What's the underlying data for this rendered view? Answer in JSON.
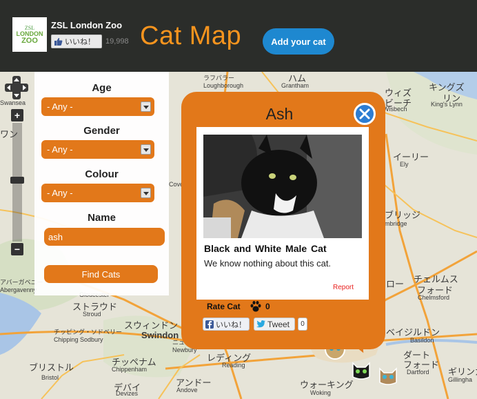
{
  "header": {
    "org_name": "ZSL London Zoo",
    "logo": {
      "line1": "ZSL",
      "line2": "LONDON",
      "line3": "ZOO"
    },
    "like_label": "いいね！",
    "like_count": "19,998",
    "site_title": "Cat Map",
    "add_cat_label": "Add your cat"
  },
  "filters": {
    "age_label": "Age",
    "age_value": "- Any -",
    "gender_label": "Gender",
    "gender_value": "- Any -",
    "colour_label": "Colour",
    "colour_value": "- Any -",
    "name_label": "Name",
    "name_value": "ash",
    "find_label": "Find Cats"
  },
  "map": {
    "labels": [
      {
        "text": "ラフバラー",
        "big": false
      },
      {
        "text": "Loughborough",
        "big": false
      },
      {
        "text": "ハム",
        "big": false
      },
      {
        "text": "Grantham",
        "big": false
      },
      {
        "text": "キングズ",
        "big": false
      },
      {
        "text": "リン",
        "big": false
      },
      {
        "text": "King's Lynn",
        "big": false
      },
      {
        "text": "ウィズ",
        "big": false
      },
      {
        "text": "ビーチ",
        "big": false
      },
      {
        "text": "Wisbech",
        "big": false
      },
      {
        "text": "イーリー",
        "big": false
      },
      {
        "text": "Ely",
        "big": false
      },
      {
        "text": "ブリッジ",
        "big": false
      },
      {
        "text": "mbridge",
        "big": false
      },
      {
        "text": "ロー",
        "big": false
      },
      {
        "text": "チェルムス",
        "big": false
      },
      {
        "text": "フォード",
        "big": false
      },
      {
        "text": "Chelmsford",
        "big": false
      },
      {
        "text": "ベイジルドン",
        "big": false
      },
      {
        "text": "Basildon",
        "big": false
      },
      {
        "text": "ダート",
        "big": false
      },
      {
        "text": "フォード",
        "big": false
      },
      {
        "text": "Dartford",
        "big": false
      },
      {
        "text": "ギリンガ",
        "big": false
      },
      {
        "text": "Gillingha",
        "big": false
      },
      {
        "text": "スウィンドン",
        "big": true
      },
      {
        "text": "Swindon",
        "big": true
      },
      {
        "text": "ストラウド",
        "big": false
      },
      {
        "text": "Stroud",
        "big": false
      },
      {
        "text": "チッピング・ソドベリー",
        "big": false
      },
      {
        "text": "Chipping Sodbury",
        "big": false
      },
      {
        "text": "ブリストル",
        "big": true
      },
      {
        "text": "Bristol",
        "big": false
      },
      {
        "text": "チッペナム",
        "big": false
      },
      {
        "text": "Chippenham",
        "big": false
      },
      {
        "text": "デバイ",
        "big": false
      },
      {
        "text": "Devizes",
        "big": false
      },
      {
        "text": "アンドー",
        "big": false
      },
      {
        "text": "Andove",
        "big": false
      },
      {
        "text": "ニューベリー",
        "big": false
      },
      {
        "text": "レディング",
        "big": true
      },
      {
        "text": "Reading",
        "big": false
      },
      {
        "text": "ウォーキング",
        "big": false
      },
      {
        "text": "Woking",
        "big": false
      },
      {
        "text": "アバーガベニー",
        "big": false
      },
      {
        "text": "Abergavenny",
        "big": false
      },
      {
        "text": "Cove",
        "big": false
      },
      {
        "text": "Gloucester",
        "big": false
      },
      {
        "text": "Swansea",
        "big": false
      },
      {
        "text": "ワン",
        "big": false
      },
      {
        "text": "Newbury",
        "big": false
      }
    ]
  },
  "popup": {
    "title": "Ash",
    "description_colour": "Black and White",
    "description_gender": "Male",
    "description_kind": "Cat",
    "about": "We know nothing about this cat.",
    "report_label": "Report",
    "rate_label": "Rate Cat",
    "rate_count": "0",
    "fb_like_label": "いいね！",
    "tweet_label": "Tweet",
    "tweet_count": "0"
  },
  "colors": {
    "header_bg": "#2b2d2a",
    "accent_orange": "#e2781a",
    "title_orange": "#f7941e",
    "button_blue": "#1e88d0",
    "close_blue": "#2d7dd2",
    "report_red": "#e8201e"
  },
  "icons": [
    "thumbs-up-icon",
    "pan-control-icon",
    "zoom-in-icon",
    "zoom-out-icon",
    "dropdown-arrow-icon",
    "close-icon",
    "paw-icon",
    "facebook-icon",
    "twitter-icon",
    "cat-marker-icon"
  ]
}
